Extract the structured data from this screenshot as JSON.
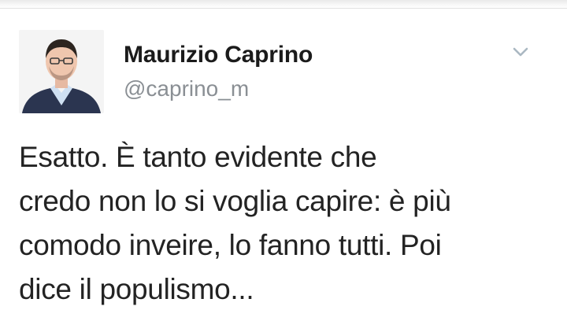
{
  "tweet": {
    "author_name": "Maurizio Caprino",
    "author_handle": "@caprino_m",
    "text_lines": [
      "Esatto. È tanto evidente che",
      "credo non lo si voglia capire: è più",
      "comodo inveire, lo fanno tutti. Poi",
      "dice il populismo..."
    ]
  },
  "icons": {
    "menu": "chevron-down-icon",
    "avatar": "profile-photo"
  },
  "colors": {
    "name": "#1b1b1b",
    "handle": "#8a8f94",
    "text": "#232323",
    "chevron": "#aab8c2",
    "background": "#ffffff"
  }
}
